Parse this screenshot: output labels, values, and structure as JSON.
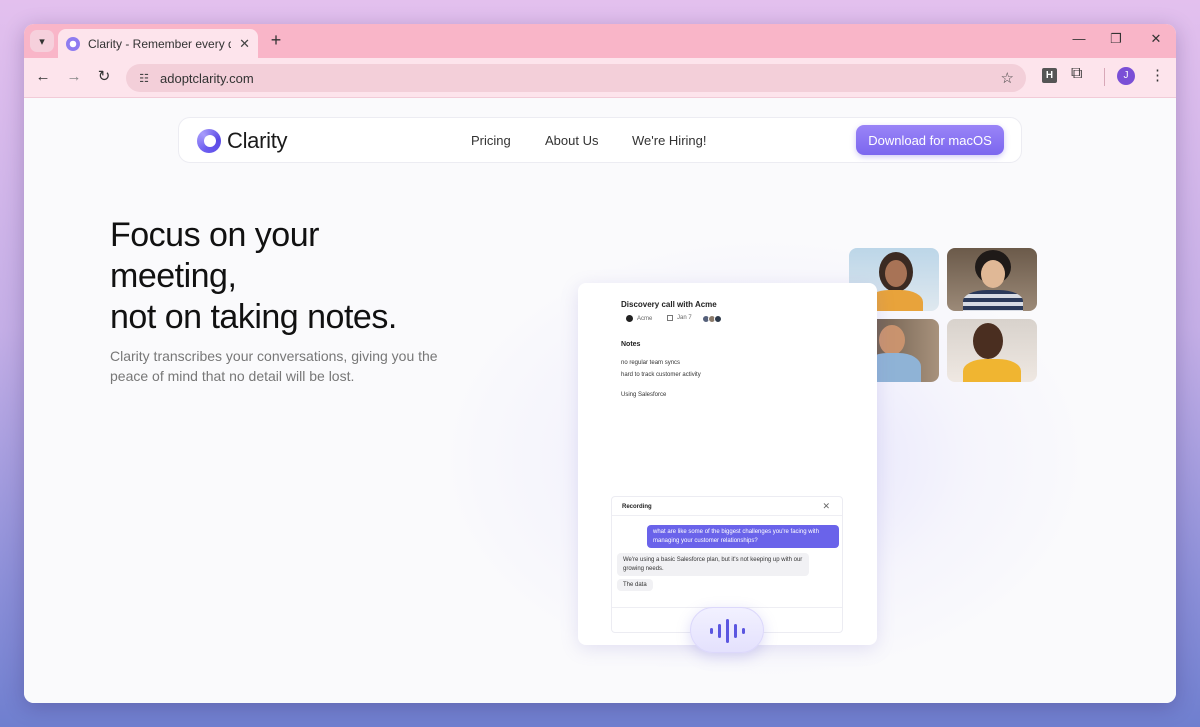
{
  "browser": {
    "tab_title": "Clarity - Remember every detail",
    "url": "adoptclarity.com",
    "profile_initial": "J",
    "extension_label": "H",
    "icons": [
      "tab-search-icon",
      "close-icon",
      "new-tab-icon",
      "minimize-icon",
      "restore-icon",
      "window-close-icon",
      "back-icon",
      "forward-icon",
      "reload-icon",
      "site-settings-icon",
      "bookmark-star-icon",
      "extensions-icon",
      "menu-icon"
    ]
  },
  "nav": {
    "logo_text": "Clarity",
    "links": [
      "Pricing",
      "About Us",
      "We're Hiring!"
    ],
    "cta": "Download for macOS"
  },
  "hero": {
    "title_line1": "Focus on your",
    "title_line2": "meeting,",
    "title_line3": "not on taking notes.",
    "subtitle": "Clarity transcribes your conversations, giving you the peace of mind that no detail will be lost."
  },
  "app_preview": {
    "meeting_title": "Discovery call with Acme",
    "company": "Acme",
    "date": "Jan 7",
    "notes_heading": "Notes",
    "notes": [
      "no regular team syncs",
      "hard to track customer activity",
      "Using Salesforce"
    ],
    "recording": {
      "heading": "Recording",
      "question": "what are like some of the biggest challenges you're facing with managing your customer relationships?",
      "answer": "We're using a basic Salesforce plan, but it's not keeping up with our growing needs.",
      "partial": "The data"
    }
  },
  "colors": {
    "accent": "#7c67ef",
    "tabbar": "#f9b5c8",
    "question_bubble": "#6a63ea"
  }
}
